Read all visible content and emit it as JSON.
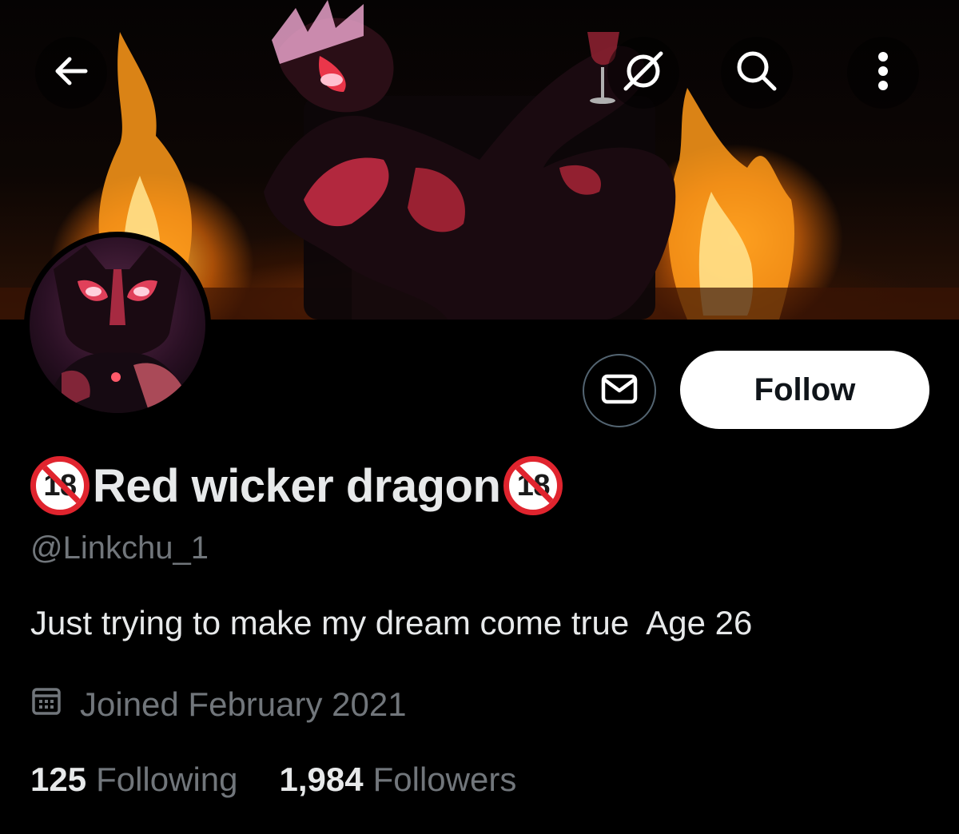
{
  "profile": {
    "display_name": "Red wicker dragon",
    "badge_text": "18",
    "handle": "@Linkchu_1",
    "bio": "Just trying to make my dream come true  Age 26",
    "joined": "Joined February 2021",
    "following_count": "125",
    "following_label": "Following",
    "followers_count": "1,984",
    "followers_label": "Followers"
  },
  "actions": {
    "follow_label": "Follow"
  },
  "icons": {
    "back": "back-arrow-icon",
    "grok": "grok-icon",
    "search": "search-icon",
    "more": "more-vertical-icon",
    "message": "envelope-icon",
    "calendar": "calendar-icon"
  },
  "colors": {
    "background": "#000000",
    "text_primary": "#e7e9ea",
    "text_secondary": "#71767b",
    "follow_button": "#ffffff",
    "badge_red": "#e0242e"
  }
}
